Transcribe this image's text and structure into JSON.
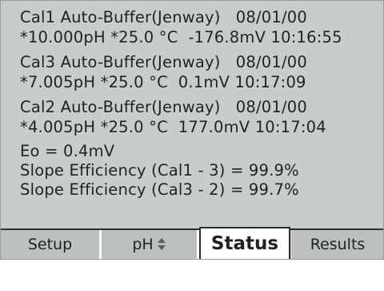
{
  "records": [
    {
      "header": "Cal1 Auto-Buffer(Jenway)   08/01/00",
      "reading": "*10.000pH *25.0 °C  -176.8mV 10:16:55"
    },
    {
      "header": "Cal3 Auto-Buffer(Jenway)   08/01/00",
      "reading": "*7.005pH *25.0 °C  0.1mV 10:17:09"
    },
    {
      "header": "Cal2 Auto-Buffer(Jenway)   08/01/00",
      "reading": "*4.005pH *25.0 °C  177.0mV 10:17:04"
    }
  ],
  "summary": {
    "eo": "Eo = 0.4mV",
    "slope1": "Slope Efficiency (Cal1 - 3) = 99.9%",
    "slope2": "Slope Efficiency (Cal3 - 2) = 99.7%"
  },
  "tabs": {
    "setup": "Setup",
    "ph": "pH",
    "ph_icon": "up-down-arrows-icon",
    "status": "Status",
    "results": "Results",
    "active": "Status"
  }
}
